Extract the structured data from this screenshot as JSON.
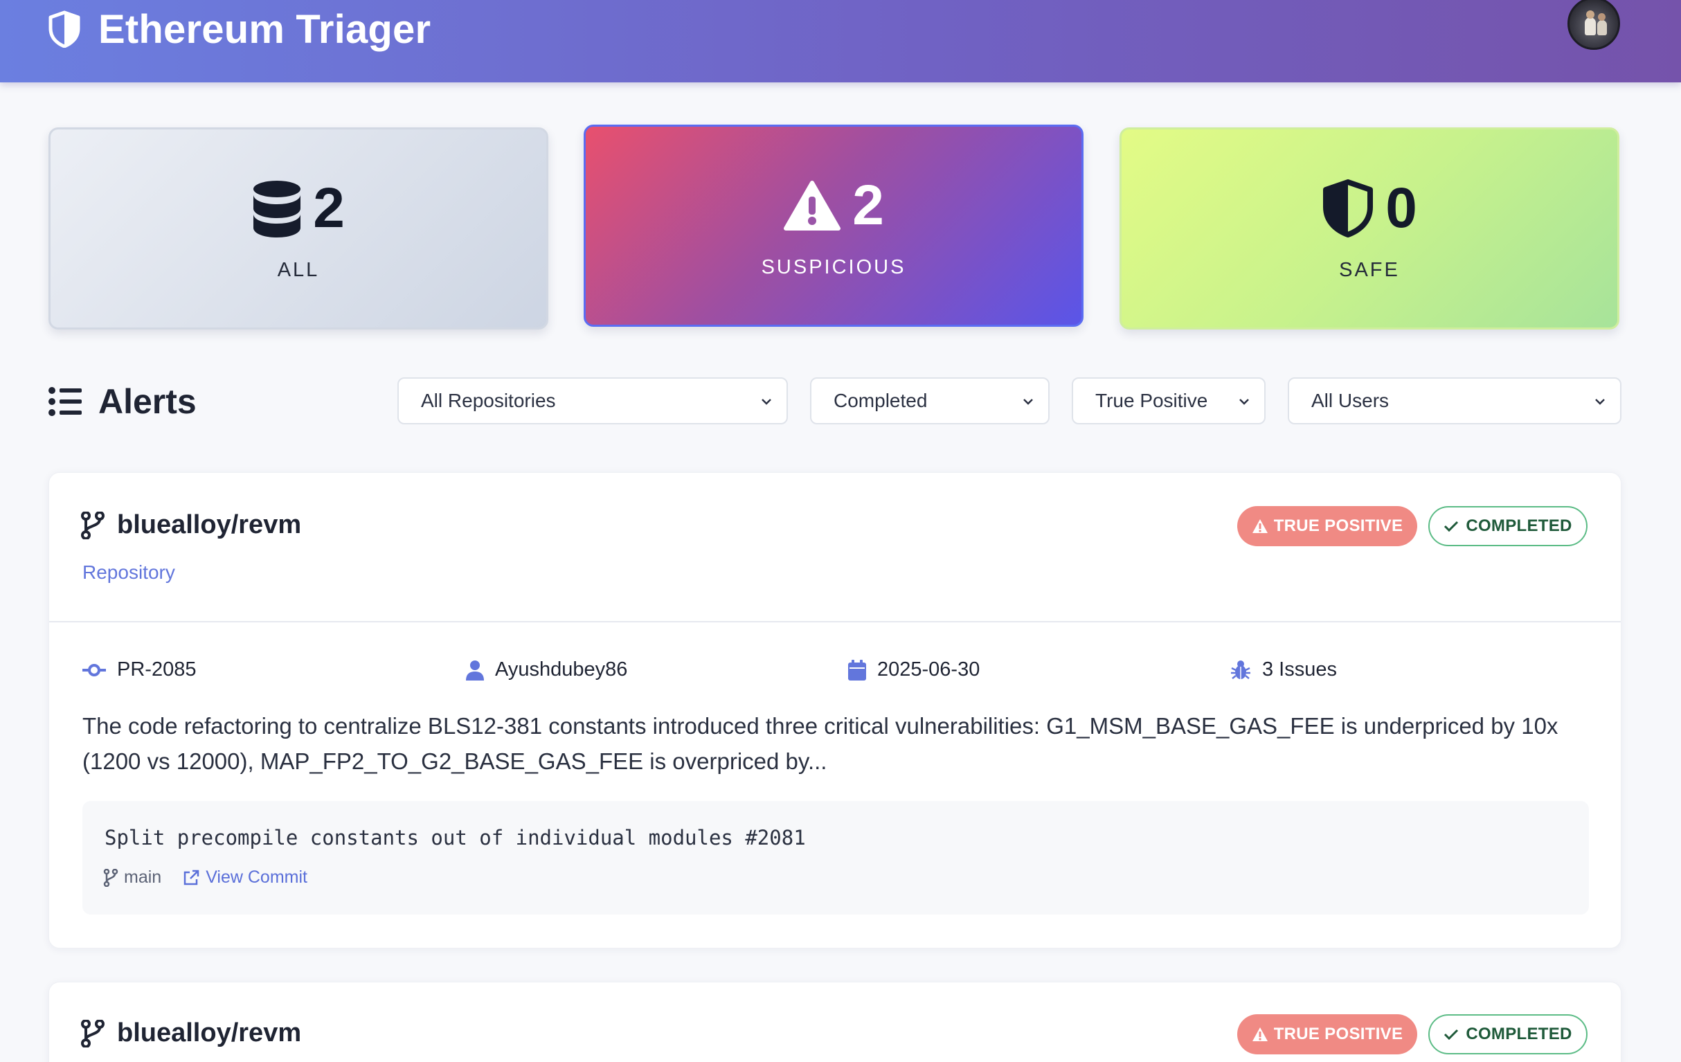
{
  "header": {
    "title": "Ethereum Triager",
    "logo_icon": "shield-half-icon",
    "avatar_icon": "user-avatar"
  },
  "stats": [
    {
      "id": "all",
      "value": "2",
      "label": "ALL",
      "icon": "database-icon"
    },
    {
      "id": "suspicious",
      "value": "2",
      "label": "SUSPICIOUS",
      "icon": "warning-triangle-icon"
    },
    {
      "id": "safe",
      "value": "0",
      "label": "SAFE",
      "icon": "shield-half-icon"
    }
  ],
  "alerts": {
    "title": "Alerts",
    "filters": {
      "repository": "All Repositories",
      "status": "Completed",
      "verdict": "True Positive",
      "user": "All Users"
    }
  },
  "cards": [
    {
      "repo": "bluealloy/revm",
      "repo_sub": "Repository",
      "verdict_badge": "TRUE POSITIVE",
      "status_badge": "COMPLETED",
      "pr": "PR-2085",
      "author": "Ayushdubey86",
      "date": "2025-06-30",
      "issues": "3 Issues",
      "summary": "The code refactoring to centralize BLS12-381 constants introduced three critical vulnerabilities: G1_MSM_BASE_GAS_FEE is underpriced by 10x (1200 vs 12000), MAP_FP2_TO_G2_BASE_GAS_FEE is overpriced by...",
      "commit_message": "Split precompile constants out of individual modules #2081",
      "branch": "main",
      "view_commit": "View Commit"
    },
    {
      "repo": "bluealloy/revm",
      "verdict_badge": "TRUE POSITIVE",
      "status_badge": "COMPLETED"
    }
  ],
  "colors": {
    "header_start": "#6b7fe0",
    "header_end": "#7553ab",
    "accent": "#6276dc",
    "true_positive": "#f08a84",
    "completed_border": "#5cbc86"
  }
}
